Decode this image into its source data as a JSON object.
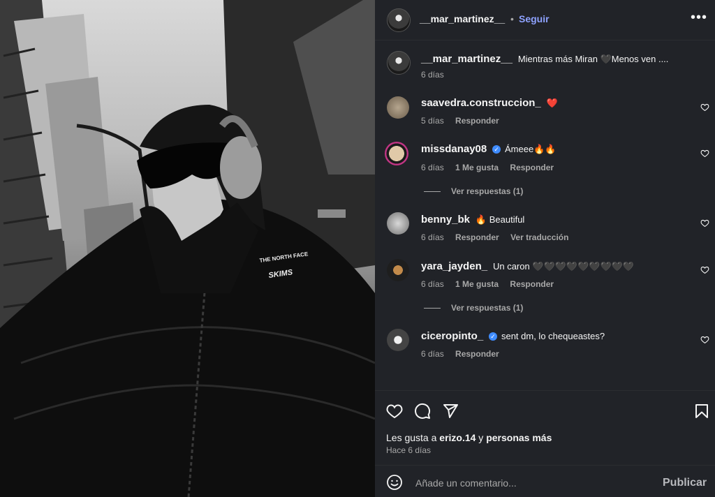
{
  "header": {
    "username": "__mar_martinez__",
    "separator": "•",
    "follow_label": "Seguir",
    "more_icon": "more-options-icon"
  },
  "caption": {
    "username": "__mar_martinez__",
    "text": "Mientras más Miran 🖤Menos ven ....",
    "time": "6 días"
  },
  "comments": [
    {
      "username": "saavedra.construccion_",
      "verified": false,
      "text": "❤️",
      "time": "5 días",
      "likes": "",
      "actions": [
        "Responder"
      ]
    },
    {
      "username": "missdanay08",
      "verified": true,
      "text": "Ámeee🔥🔥",
      "time": "6 días",
      "likes": "1 Me gusta",
      "actions": [
        "Responder"
      ],
      "replies": "Ver respuestas (1)"
    },
    {
      "username": "benny_bk",
      "verified": false,
      "text": "🔥 Beautiful",
      "time": "6 días",
      "likes": "",
      "actions": [
        "Responder",
        "Ver traducción"
      ]
    },
    {
      "username": "yara_jayden_",
      "verified": false,
      "text": "Un caron 🖤🖤🖤🖤🖤🖤🖤🖤🖤",
      "time": "6 días",
      "likes": "1 Me gusta",
      "actions": [
        "Responder"
      ],
      "replies": "Ver respuestas (1)"
    },
    {
      "username": "ciceropinto_",
      "verified": true,
      "text": "sent dm, lo chequeastes?",
      "time": "6 días",
      "likes": "",
      "actions": [
        "Responder"
      ]
    }
  ],
  "actions": {
    "like_icon": "heart-icon",
    "comment_icon": "comment-icon",
    "share_icon": "share-icon",
    "save_icon": "bookmark-icon"
  },
  "likes": {
    "prefix": "Les gusta a ",
    "user": "erizo.14",
    "middle": " y ",
    "others": "personas más"
  },
  "posted": "Hace 6 días",
  "comment_box": {
    "placeholder": "Añade un comentario...",
    "publish_label": "Publicar"
  },
  "photo": {
    "jacket_brand_top": "THE NORTH FACE",
    "jacket_brand_bottom": "SKIMS"
  }
}
